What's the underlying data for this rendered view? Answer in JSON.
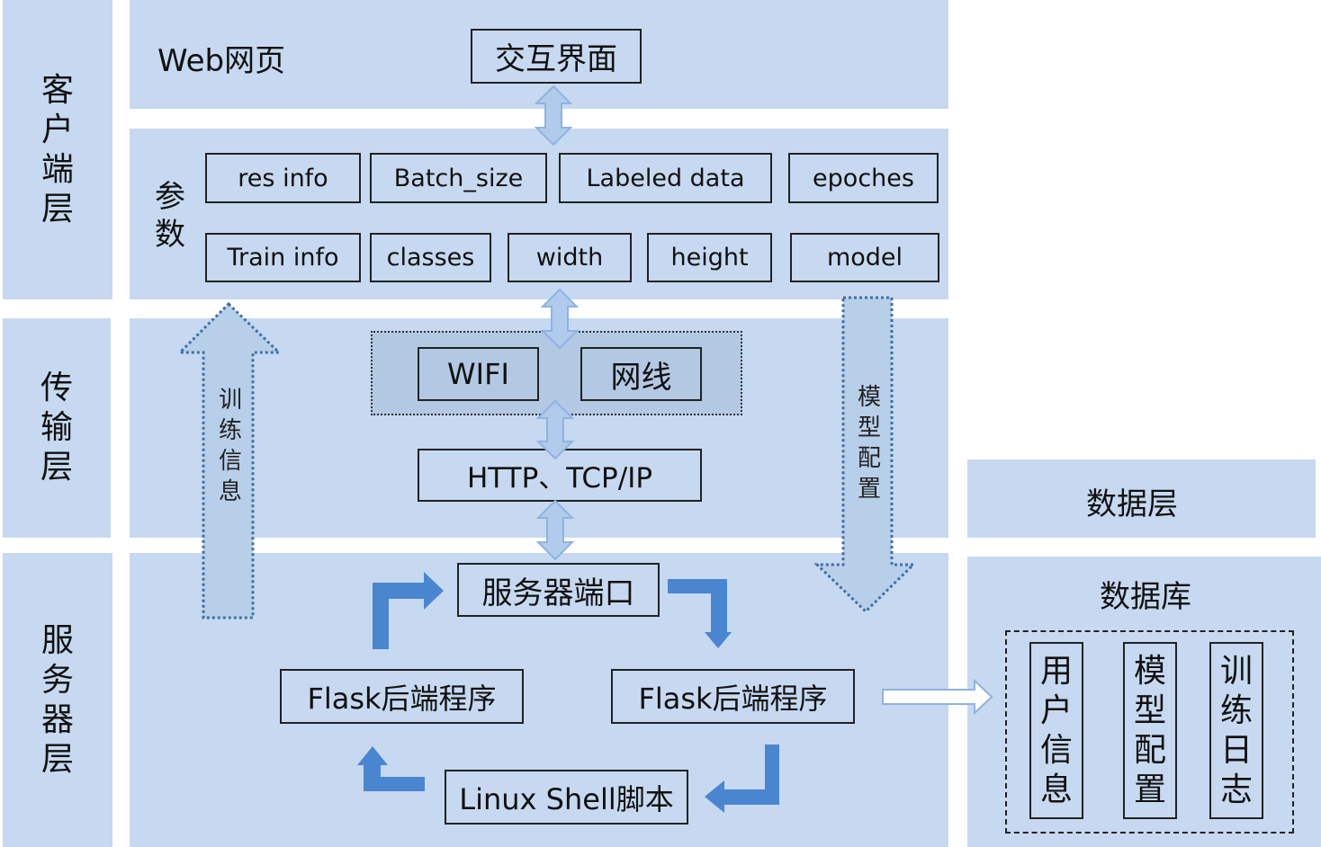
{
  "layers": {
    "client": [
      "客",
      "户",
      "端",
      "层"
    ],
    "transport": [
      "传",
      "输",
      "层"
    ],
    "server": [
      "服",
      "务",
      "器",
      "层"
    ]
  },
  "client": {
    "web_label": "Web网页",
    "ui_box": "交互界面",
    "params_label": [
      "参",
      "数"
    ],
    "params_row1": [
      "res info",
      "Batch_size",
      "Labeled data",
      "epoches"
    ],
    "params_row2": [
      "Train info",
      "classes",
      "width",
      "height",
      "model"
    ]
  },
  "transport": {
    "wifi": "WIFI",
    "cable": "网线",
    "protocol": "HTTP、TCP/IP"
  },
  "side_arrows": {
    "train_info": [
      "训",
      "练",
      "信",
      "息"
    ],
    "model_config": [
      "模",
      "型",
      "配",
      "置"
    ]
  },
  "server": {
    "port": "服务器端口",
    "flask_left": "Flask后端程序",
    "flask_right": "Flask后端程序",
    "shell": "Linux Shell脚本"
  },
  "data_layer": {
    "title": "数据层",
    "db_title": "数据库",
    "tables": [
      [
        "用",
        "户",
        "信",
        "息"
      ],
      [
        "模",
        "型",
        "配",
        "置"
      ],
      [
        "训",
        "练",
        "日",
        "志"
      ]
    ]
  },
  "colors": {
    "panel": "#c6d9f0",
    "arrow_solid": "#4a86d0",
    "arrow_light": "#9cbde6"
  }
}
